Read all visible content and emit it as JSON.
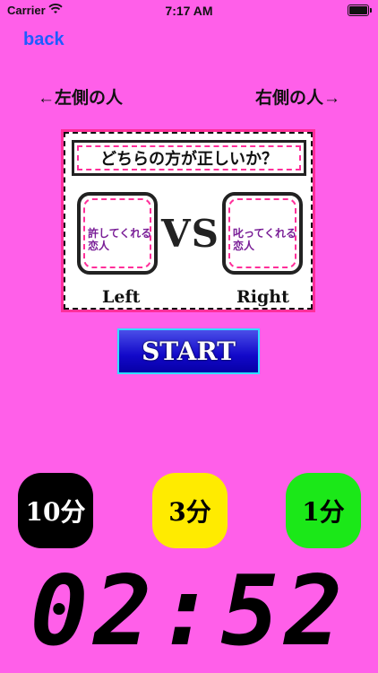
{
  "status": {
    "carrier": "Carrier",
    "time": "7:17 AM"
  },
  "nav": {
    "back_label": "back"
  },
  "sides": {
    "left": "←左側の人",
    "right": "右側の人→"
  },
  "card": {
    "question": "どちらの方が正しいか？",
    "choice_left": "許してくれる恋人",
    "choice_right": "叱ってくれる恋人",
    "vs": "VS",
    "label_left": "Left",
    "label_right": "Right"
  },
  "start_label": "START",
  "time_buttons": [
    {
      "label": "10分",
      "color": "#000000"
    },
    {
      "label": "3分",
      "color": "#ffeb00"
    },
    {
      "label": "1分",
      "color": "#1be818"
    }
  ],
  "timer": "02:52",
  "colors": {
    "background": "#ff5fe9",
    "back_link": "#1e5cff",
    "accent_pink": "#ff2f9a"
  }
}
